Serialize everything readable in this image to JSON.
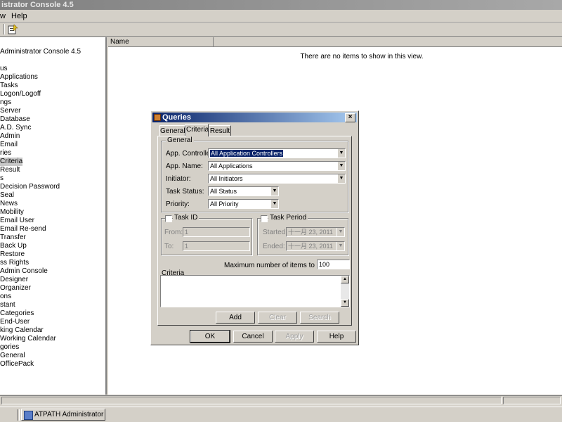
{
  "window": {
    "title": "istrator Console 4.5"
  },
  "menu": {
    "view": "w",
    "help": "Help"
  },
  "list": {
    "column_name": "Name",
    "empty_message": "There are no items to show in this view."
  },
  "tree": {
    "items": [
      "Administrator Console 4.5",
      "us",
      "Applications",
      "Tasks",
      "Logon/Logoff",
      "ngs",
      "Server",
      "Database",
      "A.D. Sync",
      "Admin",
      "Email",
      "ries",
      "Criteria",
      "Result",
      "s",
      "Decision Password",
      "Seal",
      "News",
      "Mobility",
      "Email User",
      "Email Re-send",
      "Transfer",
      "Back Up",
      "Restore",
      "ss Rights",
      "Admin Console",
      "Designer",
      "Organizer",
      "ons",
      "stant",
      "Categories",
      "End-User",
      "king Calendar",
      "Working Calendar",
      "gories",
      "General",
      "OfficePack"
    ],
    "selected_index": 12
  },
  "taskbar": {
    "app_button": "ATPATH Administrator C..."
  },
  "dialog": {
    "title": "Queries",
    "close": "×",
    "tabs": [
      "General",
      "Criteria",
      "Result"
    ],
    "general_group": {
      "label": "General",
      "app_controller_label": "App. Controller:",
      "app_controller_value": "All Application Controllers",
      "app_name_label": "App. Name:",
      "app_name_value": "All Applications",
      "initiator_label": "Initiator:",
      "initiator_value": "All Initiators",
      "task_status_label": "Task Status:",
      "task_status_value": "All Status",
      "priority_label": "Priority:",
      "priority_value": "All Priority"
    },
    "task_id": {
      "label": "Task ID",
      "from_label": "From:",
      "from_value": "1",
      "to_label": "To:",
      "to_value": "1"
    },
    "task_period": {
      "label": "Task Period",
      "started_label": "Started:",
      "started_value": "十一月 23, 2011",
      "ended_label": "Ended:",
      "ended_value": "十一月 23, 2011"
    },
    "max_items_label": "Maximum number of items to display:",
    "max_items_value": "100",
    "criteria_label": "Criteria",
    "buttons": {
      "add": "Add",
      "clear": "Clear",
      "search": "Search",
      "ok": "OK",
      "cancel": "Cancel",
      "apply": "Apply",
      "help": "Help"
    }
  }
}
